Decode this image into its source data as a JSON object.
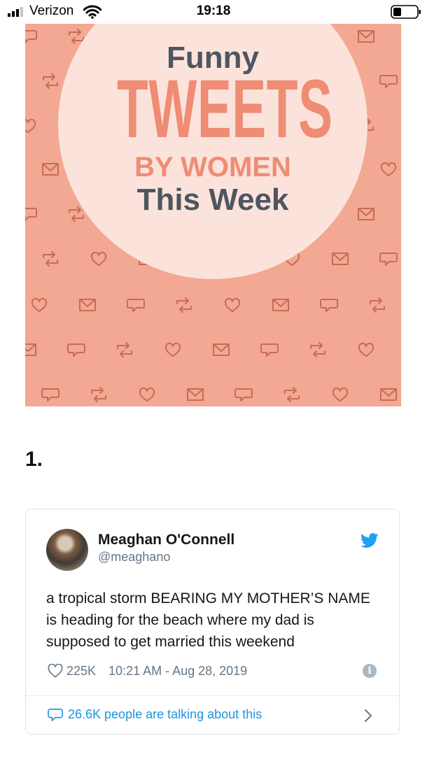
{
  "status_bar": {
    "carrier": "Verizon",
    "time": "19:18"
  },
  "hero": {
    "line1": "Funny",
    "line2": "TWEETS",
    "line3": "BY WOMEN",
    "line4": "This Week",
    "colors": {
      "background": "#f2a892",
      "circle": "#fbe3db",
      "accent": "#ef8c74",
      "dark": "#4e5660"
    }
  },
  "list_number": "1.",
  "tweet": {
    "author_name": "Meaghan O'Connell",
    "author_handle": "@meaghano",
    "text": "a tropical storm BEARING MY MOTHER’S NAME is heading for the beach where my dad is supposed to get married this weekend",
    "likes": "225K",
    "timestamp": "10:21 AM - Aug 28, 2019",
    "talking": "26.6K people are talking about this",
    "brand_color": "#1da1f2"
  }
}
